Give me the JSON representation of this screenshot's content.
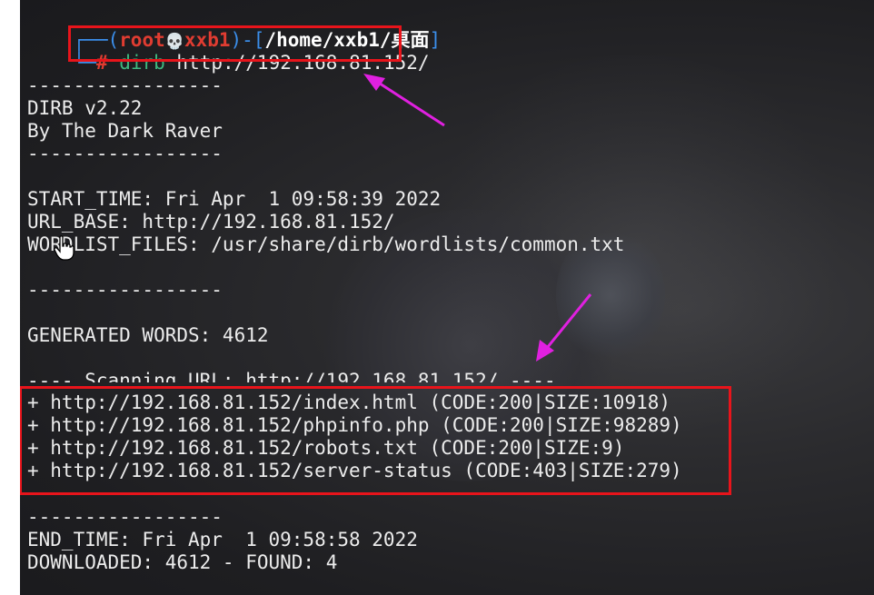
{
  "prompt": {
    "frame_open": "┌──(",
    "user": "root",
    "skull": "💀",
    "host": "xxb1",
    "frame_mid": ")-[",
    "path": "/home/xxb1/桌面",
    "frame_close": "]",
    "frame_bottom": "└─",
    "hash": "#",
    "command": "dirb",
    "argument": "http://192.168.81.152/"
  },
  "output": {
    "sep1": "-----------------",
    "version": "DIRB v2.22",
    "author": "By The Dark Raver",
    "sep2": "-----------------",
    "start_time": "START_TIME: Fri Apr  1 09:58:39 2022",
    "url_base": "URL_BASE: http://192.168.81.152/",
    "wordlist": "WORDLIST_FILES: /usr/share/dirb/wordlists/common.txt",
    "sep3": "-----------------",
    "generated": "GENERATED WORDS: 4612",
    "scanning": "---- Scanning URL: http://192.168.81.152/ ----",
    "results": [
      "+ http://192.168.81.152/index.html (CODE:200|SIZE:10918)",
      "+ http://192.168.81.152/phpinfo.php (CODE:200|SIZE:98289)",
      "+ http://192.168.81.152/robots.txt (CODE:200|SIZE:9)",
      "+ http://192.168.81.152/server-status (CODE:403|SIZE:279)"
    ],
    "sep4": "-----------------",
    "end_time": "END_TIME: Fri Apr  1 09:58:58 2022",
    "summary": "DOWNLOADED: 4612 - FOUND: 4"
  },
  "colors": {
    "terminal_bg": "#1e1e21",
    "prompt_frame": "#3b8eea",
    "prompt_user": "#e03c31",
    "command": "#3fb87f",
    "text": "#ececec",
    "highlight_box": "#e8141b",
    "arrow": "#e020e0"
  },
  "icons": {
    "skull": "skull-icon",
    "cursor": "hand-cursor-icon",
    "arrow": "annotation-arrow-icon"
  }
}
